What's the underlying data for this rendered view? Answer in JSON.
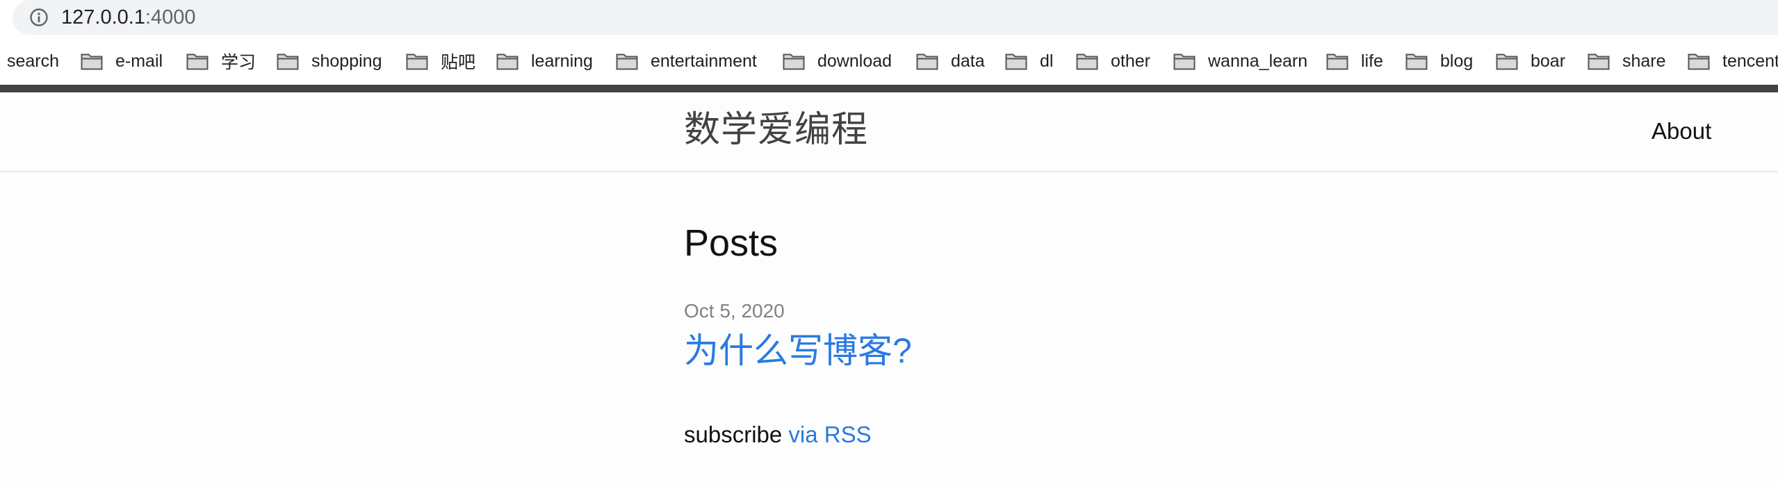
{
  "browser": {
    "url_host": "127.0.0.1",
    "url_port": ":4000",
    "info_icon": "info-icon",
    "bookmarks": [
      {
        "label": "search",
        "folder": false
      },
      {
        "label": "e-mail",
        "folder": true
      },
      {
        "label": "学习",
        "folder": true
      },
      {
        "label": "shopping",
        "folder": true
      },
      {
        "label": "贴吧",
        "folder": true
      },
      {
        "label": "learning",
        "folder": true
      },
      {
        "label": "entertainment",
        "folder": true
      },
      {
        "label": "download",
        "folder": true
      },
      {
        "label": "data",
        "folder": true
      },
      {
        "label": "dl",
        "folder": true
      },
      {
        "label": "other",
        "folder": true
      },
      {
        "label": "wanna_learn",
        "folder": true
      },
      {
        "label": "life",
        "folder": true
      },
      {
        "label": "blog",
        "folder": true
      },
      {
        "label": "boar",
        "folder": true
      },
      {
        "label": "share",
        "folder": true
      },
      {
        "label": "tencent",
        "folder": true
      }
    ],
    "folder_icon": "folder-icon"
  },
  "site": {
    "title": "数学爱编程",
    "nav": {
      "about": "About"
    }
  },
  "main": {
    "heading": "Posts",
    "posts": [
      {
        "date": "Oct 5, 2020",
        "title": "为什么写博客?"
      }
    ],
    "subscribe_prefix": "subscribe ",
    "subscribe_link": "via RSS"
  },
  "colors": {
    "link": "#2a7ae2",
    "meta": "#828282",
    "header_rule": "#424242"
  }
}
